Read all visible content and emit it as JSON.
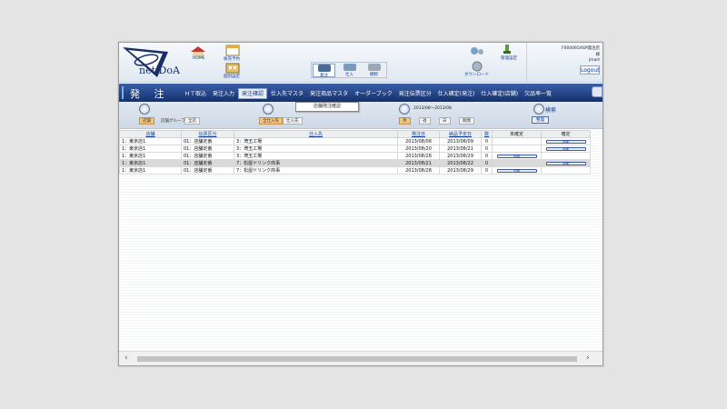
{
  "brand": {
    "logo_text": "net DoA"
  },
  "header": {
    "shortcuts": [
      {
        "label": "HOME",
        "icon": "house-icon"
      },
      {
        "label": "販売予約",
        "icon": "calendar-icon"
      },
      {
        "label": "個別設定",
        "icon": "settings-building-icon"
      }
    ],
    "modes": [
      {
        "label": "発注",
        "icon": "order-icon",
        "active": true
      },
      {
        "label": "仕入",
        "icon": "purchase-icon"
      },
      {
        "label": "棚卸",
        "icon": "inventory-icon"
      }
    ],
    "right_icons": [
      {
        "label": "管理設定",
        "icon": "admin-settings-icon"
      },
      {
        "label": "ダウンロード",
        "icon": "download-icon"
      }
    ]
  },
  "user": {
    "company": "F000065ASP発注店",
    "line2": "様",
    "name": "jmart",
    "logout_label": "Logout"
  },
  "title": "発 注",
  "tabs": [
    {
      "label": "ＨＴ取込"
    },
    {
      "label": "発注入力"
    },
    {
      "label": "発注確認",
      "active": true
    },
    {
      "label": "仕入先マスタ"
    },
    {
      "label": "発注商品マスタ"
    },
    {
      "label": "オーダーブック"
    },
    {
      "label": "発注伝票区分"
    },
    {
      "label": "仕入確定(発注)"
    },
    {
      "label": "仕入確定(店舗)"
    },
    {
      "label": "欠品率一覧"
    }
  ],
  "tooltip": "店舗発注確認",
  "filters": {
    "store": {
      "buttons": [
        "店舗",
        "店舗グループ",
        "全店"
      ]
    },
    "supplier": {
      "buttons": [
        "全仕入先",
        "仕入先"
      ]
    },
    "period": {
      "range": "2013/08〜2013/08",
      "buttons": [
        "月",
        "週",
        "日",
        "期間"
      ]
    },
    "search_label": "検索",
    "search_button": "整理"
  },
  "table": {
    "headers": [
      "店舗",
      "伝票区分",
      "仕入先",
      "発注日",
      "納品予定日",
      "数",
      "未確定",
      "確定"
    ],
    "rows": [
      {
        "store": "1：東京店1",
        "slip": "01：店舗定番",
        "supplier": "3：埼玉工場",
        "order_date": "2013/08/08",
        "delivery": "2013/08/09",
        "count": "0",
        "unconfirmed": "",
        "confirmed": "詳細"
      },
      {
        "store": "1：東京店1",
        "slip": "01：店舗定番",
        "supplier": "3：埼玉工場",
        "order_date": "2013/08/20",
        "delivery": "2013/08/21",
        "count": "0",
        "unconfirmed": "",
        "confirmed": "詳細"
      },
      {
        "store": "1：東京店1",
        "slip": "01：店舗定番",
        "supplier": "3：埼玉工場",
        "order_date": "2013/08/28",
        "delivery": "2013/08/29",
        "count": "0",
        "unconfirmed": "詳細",
        "confirmed": ""
      },
      {
        "store": "1：東京店1",
        "slip": "01：店舗定番",
        "supplier": "7：松屋ドリンク商事",
        "order_date": "2013/08/21",
        "delivery": "2013/08/22",
        "count": "0",
        "unconfirmed": "",
        "confirmed": "詳細"
      },
      {
        "store": "1：東京店1",
        "slip": "01：店舗定番",
        "supplier": "7：松屋ドリンク商事",
        "order_date": "2013/08/28",
        "delivery": "2013/08/29",
        "count": "0",
        "unconfirmed": "詳細",
        "confirmed": ""
      }
    ]
  },
  "colors": {
    "title_bar": "#1e3f86",
    "active_filter": "#f5c47d",
    "link": "#123f9a"
  }
}
